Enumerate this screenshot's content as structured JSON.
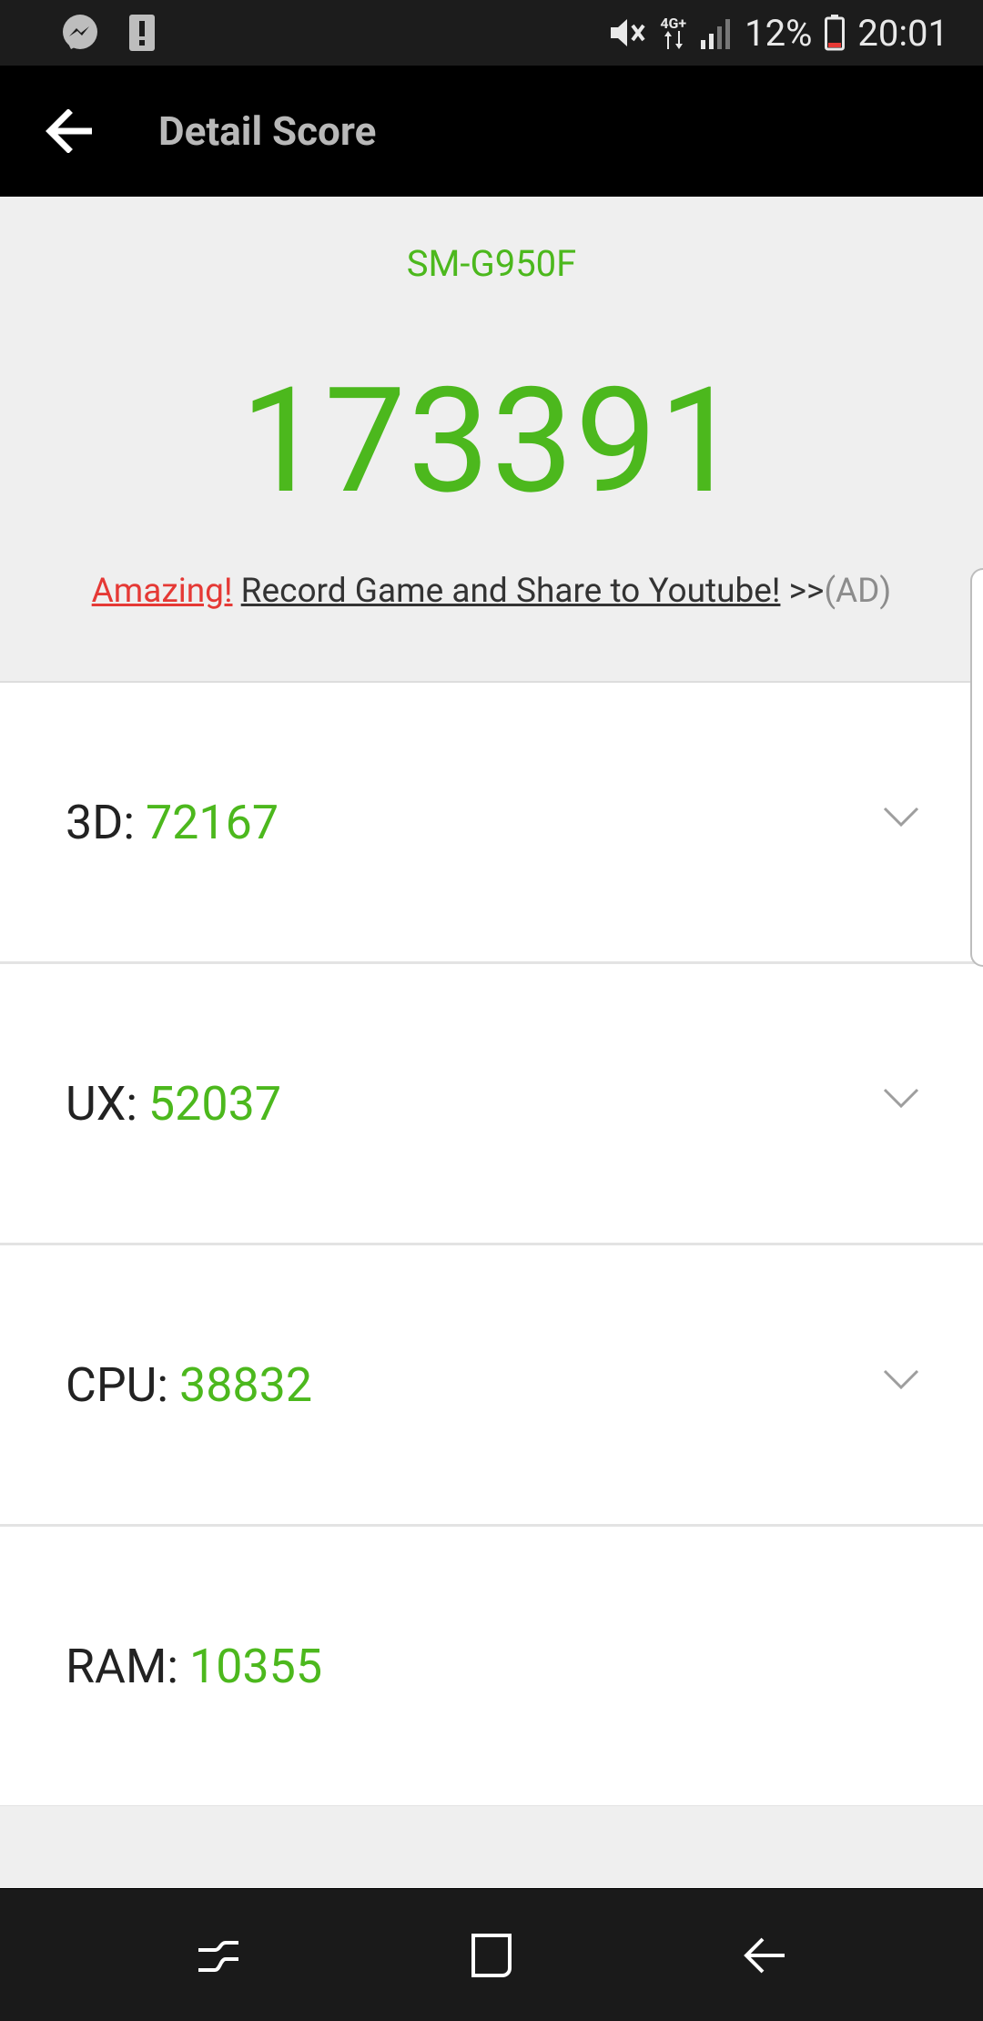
{
  "status_bar": {
    "battery_percent": "12%",
    "time": "20:01",
    "network": "4G+",
    "icons": [
      "messenger-icon",
      "alert-icon",
      "mute-icon",
      "network-4g-icon",
      "signal-icon",
      "battery-low-icon"
    ]
  },
  "toolbar": {
    "title": "Detail Score",
    "back_icon": "arrow-left-icon"
  },
  "header": {
    "device": "SM-G950F",
    "total_score": "173391",
    "ad": {
      "amazing": "Amazing!",
      "link": "Record Game and Share to Youtube!",
      "arrows": ">>",
      "tag": "(AD)"
    }
  },
  "scores": [
    {
      "label": "3D:",
      "value": "72167",
      "expandable": true
    },
    {
      "label": "UX:",
      "value": "52037",
      "expandable": true
    },
    {
      "label": "CPU:",
      "value": "38832",
      "expandable": true
    },
    {
      "label": "RAM:",
      "value": "10355",
      "expandable": false
    }
  ],
  "nav": {
    "items": [
      "recent-apps-icon",
      "home-icon",
      "back-icon"
    ]
  },
  "colors": {
    "accent_green": "#4cb81d",
    "ad_red": "#e53935",
    "toolbar_bg": "#000000",
    "header_bg": "#efefef"
  }
}
